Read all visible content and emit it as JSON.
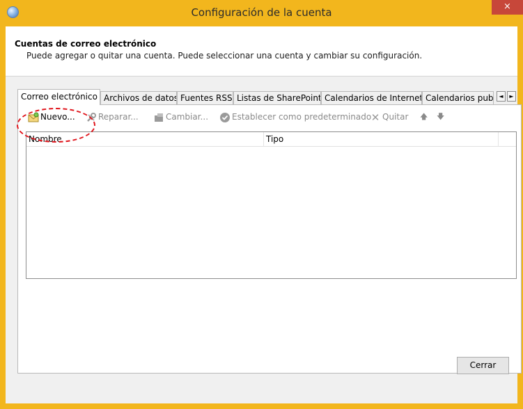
{
  "window": {
    "title": "Configuración de la cuenta",
    "close_glyph": "×",
    "frame_color": "#f2b61d"
  },
  "header": {
    "title": "Cuentas de correo electrónico",
    "subtitle": "Puede agregar o quitar una cuenta. Puede seleccionar una cuenta y cambiar su configuración."
  },
  "tabs": [
    {
      "label": "Correo electrónico",
      "active": true
    },
    {
      "label": "Archivos de datos",
      "active": false
    },
    {
      "label": "Fuentes RSS",
      "active": false
    },
    {
      "label": "Listas de SharePoint",
      "active": false
    },
    {
      "label": "Calendarios de Internet",
      "active": false
    },
    {
      "label": "Calendarios publi",
      "active": false
    }
  ],
  "tab_scroll": {
    "left": "◄",
    "right": "►"
  },
  "toolbar": {
    "new_label": "Nuevo...",
    "repair_label": "Reparar...",
    "change_label": "Cambiar...",
    "default_label": "Establecer como predeterminado",
    "remove_label": "Quitar",
    "up_glyph": "🡅",
    "down_glyph": "🡇",
    "remove_glyph": "✕"
  },
  "list": {
    "columns": [
      "Nombre",
      "Tipo"
    ],
    "rows": []
  },
  "footer": {
    "close_label": "Cerrar"
  },
  "annotation": {
    "color": "#e0141b"
  }
}
